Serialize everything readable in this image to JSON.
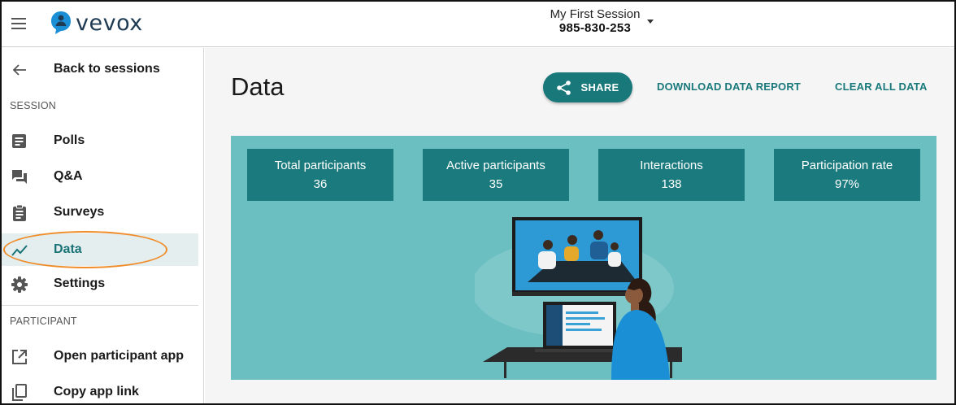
{
  "app": {
    "brand": "vevox",
    "session_name": "My First Session",
    "session_code": "985-830-253",
    "colors": {
      "teal": "#18787a",
      "teal_panel": "#6cbfc1",
      "highlight": "#f08c28"
    }
  },
  "sidebar": {
    "back_label": "Back to sessions",
    "session_section": "SESSION",
    "items": [
      {
        "label": "Polls",
        "icon": "polls-icon"
      },
      {
        "label": "Q&A",
        "icon": "qa-icon"
      },
      {
        "label": "Surveys",
        "icon": "surveys-icon"
      },
      {
        "label": "Data",
        "icon": "data-trend-icon",
        "active": true
      },
      {
        "label": "Settings",
        "icon": "gear-icon"
      }
    ],
    "participant_section": "PARTICIPANT",
    "participant_items": [
      {
        "label": "Open participant app",
        "icon": "open-external-icon"
      },
      {
        "label": "Copy app link",
        "icon": "copy-icon"
      }
    ]
  },
  "main": {
    "title": "Data",
    "share_label": "SHARE",
    "download_label": "DOWNLOAD DATA REPORT",
    "clear_label": "CLEAR ALL DATA",
    "stats": [
      {
        "label": "Total participants",
        "value": "36"
      },
      {
        "label": "Active participants",
        "value": "35"
      },
      {
        "label": "Interactions",
        "value": "138"
      },
      {
        "label": "Participation rate",
        "value": "97%"
      }
    ]
  }
}
